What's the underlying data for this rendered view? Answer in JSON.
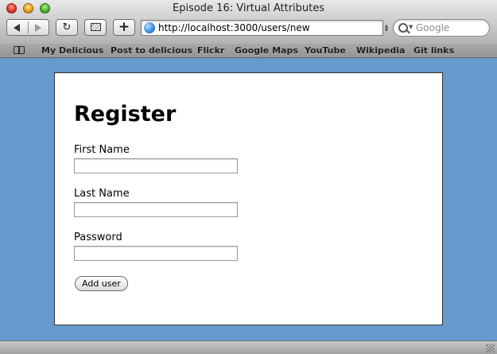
{
  "window": {
    "title": "Episode 16: Virtual Attributes"
  },
  "toolbar": {
    "reload_glyph": "↻",
    "add_glyph": "+",
    "url": "http://localhost:3000/users/new",
    "search_placeholder": "Google"
  },
  "bookmarks": {
    "items": [
      {
        "label": "My Delicious"
      },
      {
        "label": "Post to delicious"
      },
      {
        "label": "Flickr"
      },
      {
        "label": "Google Maps"
      },
      {
        "label": "YouTube"
      },
      {
        "label": "Wikipedia"
      },
      {
        "label": "Git links"
      }
    ]
  },
  "form": {
    "title": "Register",
    "first_name_label": "First Name",
    "first_name_value": "",
    "last_name_label": "Last Name",
    "last_name_value": "",
    "password_label": "Password",
    "password_value": "",
    "submit_label": "Add user"
  },
  "colors": {
    "page_background": "#6699CC",
    "card_background": "#FFFFFF"
  }
}
